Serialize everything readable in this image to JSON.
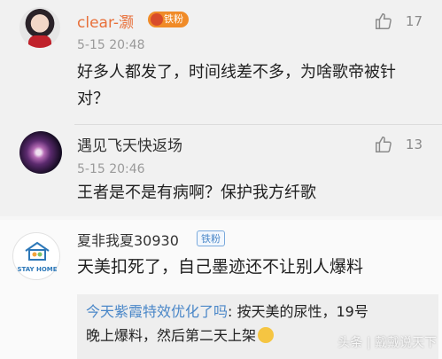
{
  "comments": [
    {
      "name": "clear-灏",
      "badge": "铁粉",
      "time": "5-15 20:48",
      "text_line1": "好多人都发了，时间线差不多，为啥歌帝被针",
      "text_line2": "对？",
      "likes": "17"
    },
    {
      "name": "遇见飞天快返场",
      "time": "5-15 20:46",
      "text": "王者是不是有病啊？保护我方纤歌",
      "likes": "13"
    }
  ],
  "third": {
    "name": "夏非我夏30930",
    "badge": "铁粉",
    "avatar_text": "STAY HOME",
    "text": "天美扣死了，自己墨迹还不让别人爆料",
    "reply_user": "今天紫霞特效优化了吗",
    "reply_line1": ": 按天美的尿性，19号",
    "reply_line2": "晚上爆料，然后第二天上架"
  },
  "watermark": "头条 | 戴戴说天下",
  "icons": {
    "like": "thumb-up-icon",
    "badge_crown": "crown-icon",
    "emoji": "emoji-icon"
  },
  "colors": {
    "accent_orange": "#e8703a",
    "badge_orange": "#f08b28",
    "link_blue": "#4a87c8"
  }
}
